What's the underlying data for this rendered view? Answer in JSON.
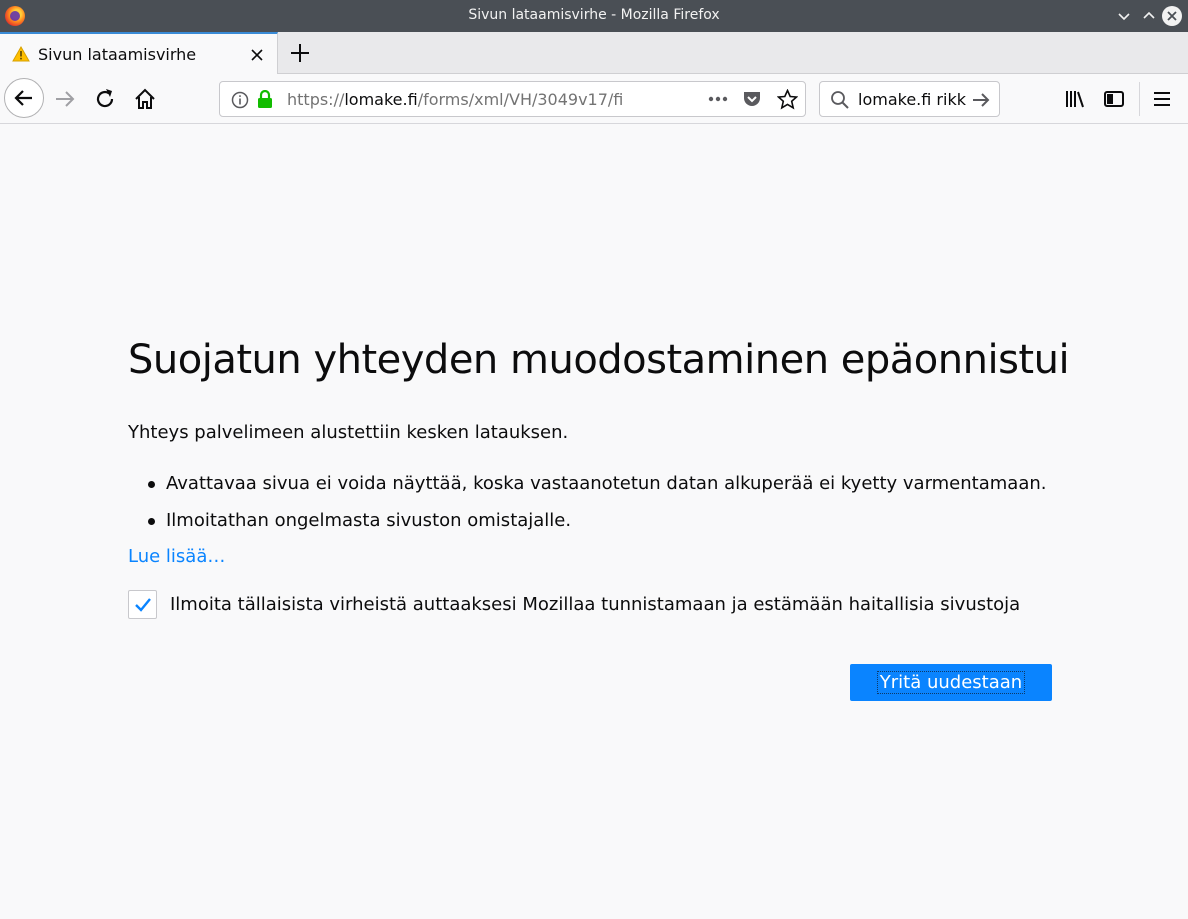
{
  "window": {
    "title": "Sivun lataamisvirhe - Mozilla Firefox"
  },
  "tab": {
    "label": "Sivun lataamisvirhe"
  },
  "urlbar": {
    "scheme": "https://",
    "host": "lomake.fi",
    "path": "/forms/xml/VH/3049v17/fi"
  },
  "searchbar": {
    "value": "lomake.fi rikk"
  },
  "error": {
    "title": "Suojatun yhteyden muodostaminen epäonnistui",
    "description": "Yhteys palvelimeen alustettiin kesken latauksen.",
    "bullets": [
      "Avattavaa sivua ei voida näyttää, koska vastaanotetun datan alkuperää ei kyetty varmentamaan.",
      "Ilmoitathan ongelmasta sivuston omistajalle."
    ],
    "learn_more": "Lue lisää…",
    "report_label": "Ilmoita tällaisista virheistä auttaaksesi Mozillaa tunnistamaan ja estämään haitallisia sivustoja",
    "report_checked": true,
    "retry_label": "Yritä uudestaan"
  },
  "colors": {
    "accent": "#0a84ff",
    "titlebar": "#4a4f55",
    "lock": "#12bc00"
  }
}
